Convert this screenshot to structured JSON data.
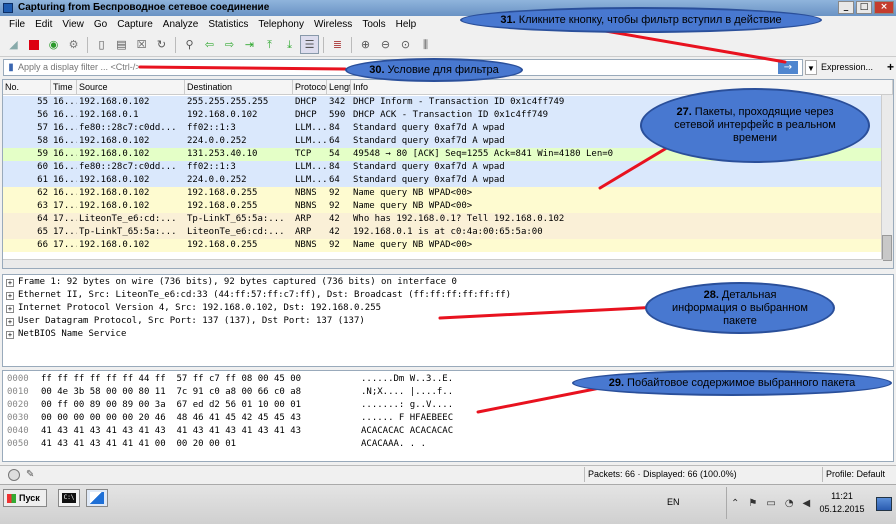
{
  "window": {
    "title": "Capturing from Беспроводное сетевое соединение",
    "controls": [
      "_",
      "□",
      "×"
    ]
  },
  "menu": [
    "File",
    "Edit",
    "View",
    "Go",
    "Capture",
    "Analyze",
    "Statistics",
    "Telephony",
    "Wireless",
    "Tools",
    "Help"
  ],
  "filter": {
    "placeholder": "Apply a display filter ... <Ctrl-/>",
    "expression_label": "Expression...",
    "plus_label": "+"
  },
  "packet_list": {
    "columns": [
      "No.",
      "Time",
      "Source",
      "Destination",
      "Protocol",
      "Length",
      "Info"
    ],
    "rows": [
      {
        "no": "55",
        "time": "16...",
        "src": "192.168.0.102",
        "dst": "255.255.255.255",
        "proto": "DHCP",
        "len": "342",
        "info": "DHCP Inform    - Transaction ID 0x1c4ff749",
        "color": "#dae8fc"
      },
      {
        "no": "56",
        "time": "16...",
        "src": "192.168.0.1",
        "dst": "192.168.0.102",
        "proto": "DHCP",
        "len": "590",
        "info": "DHCP ACK       - Transaction ID 0x1c4ff749",
        "color": "#dae8fc"
      },
      {
        "no": "57",
        "time": "16...",
        "src": "fe80::28c7:c0dd...",
        "dst": "ff02::1:3",
        "proto": "LLM...",
        "len": "84",
        "info": "Standard query 0xaf7d A wpad",
        "color": "#dae8fc"
      },
      {
        "no": "58",
        "time": "16...",
        "src": "192.168.0.102",
        "dst": "224.0.0.252",
        "proto": "LLM...",
        "len": "64",
        "info": "Standard query 0xaf7d A wpad",
        "color": "#dae8fc"
      },
      {
        "no": "59",
        "time": "16...",
        "src": "192.168.0.102",
        "dst": "131.253.40.10",
        "proto": "TCP",
        "len": "54",
        "info": "49548 → 80 [ACK] Seq=1255 Ack=841 Win=4180 Len=0",
        "color": "#e4ffc7"
      },
      {
        "no": "60",
        "time": "16...",
        "src": "fe80::28c7:c0dd...",
        "dst": "ff02::1:3",
        "proto": "LLM...",
        "len": "84",
        "info": "Standard query 0xaf7d A wpad",
        "color": "#dae8fc"
      },
      {
        "no": "61",
        "time": "16...",
        "src": "192.168.0.102",
        "dst": "224.0.0.252",
        "proto": "LLM...",
        "len": "64",
        "info": "Standard query 0xaf7d A wpad",
        "color": "#dae8fc"
      },
      {
        "no": "62",
        "time": "16...",
        "src": "192.168.0.102",
        "dst": "192.168.0.255",
        "proto": "NBNS",
        "len": "92",
        "info": "Name query NB WPAD<00>",
        "color": "#fefbd0"
      },
      {
        "no": "63",
        "time": "17...",
        "src": "192.168.0.102",
        "dst": "192.168.0.255",
        "proto": "NBNS",
        "len": "92",
        "info": "Name query NB WPAD<00>",
        "color": "#fefbd0"
      },
      {
        "no": "64",
        "time": "17...",
        "src": "LiteonTe_e6:cd:...",
        "dst": "Tp-LinkT_65:5a:...",
        "proto": "ARP",
        "len": "42",
        "info": "Who has 192.168.0.1? Tell 192.168.0.102",
        "color": "#faf0d7"
      },
      {
        "no": "65",
        "time": "17...",
        "src": "Tp-LinkT_65:5a:...",
        "dst": "LiteonTe_e6:cd:...",
        "proto": "ARP",
        "len": "42",
        "info": "192.168.0.1 is at c0:4a:00:65:5a:00",
        "color": "#faf0d7"
      },
      {
        "no": "66",
        "time": "17...",
        "src": "192.168.0.102",
        "dst": "192.168.0.255",
        "proto": "NBNS",
        "len": "92",
        "info": "Name query NB WPAD<00>",
        "color": "#fefbd0"
      }
    ]
  },
  "details": [
    "Frame 1: 92 bytes on wire (736 bits), 92 bytes captured (736 bits) on interface 0",
    "Ethernet II, Src: LiteonTe_e6:cd:33 (44:ff:57:ff:c7:ff), Dst: Broadcast (ff:ff:ff:ff:ff:ff)",
    "Internet Protocol Version 4, Src: 192.168.0.102, Dst: 192.168.0.255",
    "User Datagram Protocol, Src Port: 137 (137), Dst Port: 137 (137)",
    "NetBIOS Name Service"
  ],
  "bytes": [
    {
      "offset": "0000",
      "hex": "ff ff ff ff ff ff 44 ff  57 ff c7 ff 08 00 45 00",
      "ascii": "......Dm W..3..E."
    },
    {
      "offset": "0010",
      "hex": "00 4e 3b 58 00 00 80 11  7c 91 c0 a8 00 66 c0 a8",
      "ascii": ".N;X.... |....f.."
    },
    {
      "offset": "0020",
      "hex": "00 ff 00 89 00 89 00 3a  67 ed d2 56 01 10 00 01",
      "ascii": ".......: g..V...."
    },
    {
      "offset": "0030",
      "hex": "00 00 00 00 00 00 20 46  48 46 41 45 42 45 45 43",
      "ascii": "...... F HFAEBEEC"
    },
    {
      "offset": "0040",
      "hex": "41 43 41 43 41 43 41 43  41 43 41 43 41 43 41 43",
      "ascii": "ACACACAC ACACACAC"
    },
    {
      "offset": "0050",
      "hex": "41 43 41 43 41 41 41 00  00 20 00 01",
      "ascii": "ACACAAA. . ."
    }
  ],
  "status": {
    "packets": "Packets: 66 · Displayed: 66 (100.0%)",
    "profile": "Profile: Default"
  },
  "taskbar": {
    "start_label": "Пуск",
    "cmd_label": "C:\\",
    "lang": "EN",
    "time": "11:21",
    "date": "05.12.2015"
  },
  "callouts": {
    "c31": {
      "num": "31.",
      "text": "Кликните кнопку, чтобы фильтр вступил в действие"
    },
    "c30": {
      "num": "30.",
      "text": "Условие для фильтра"
    },
    "c27": {
      "num": "27.",
      "text": "Пакеты, проходящие через сетевой интерфейс в реальном времени"
    },
    "c28": {
      "num": "28.",
      "text": "Детальная информация о выбранном пакете"
    },
    "c29": {
      "num": "29.",
      "text": "Побайтовое содержимое выбранного пакета"
    }
  },
  "colors": {
    "callout_fill": "#4878d0",
    "arrow": "#e8121f",
    "apply_button": "#4f86cf"
  }
}
